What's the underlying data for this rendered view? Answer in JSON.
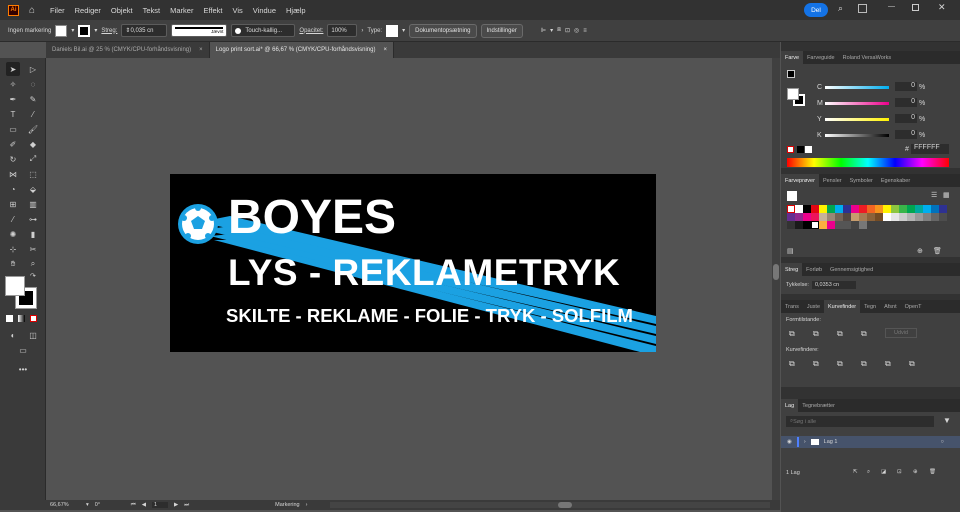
{
  "menu": {
    "items": [
      "Filer",
      "Rediger",
      "Objekt",
      "Tekst",
      "Marker",
      "Effekt",
      "Vis",
      "Vindue",
      "Hjælp"
    ],
    "share": "Del"
  },
  "control": {
    "selection": "Ingen markering",
    "stroke_label": "Streg:",
    "stroke_value": "0,035 cn",
    "brush_profile": "Jævnt",
    "brush_name": "Touch-kallig...",
    "opacity_label": "Opacitet:",
    "opacity_value": "100%",
    "style_label": "Type:",
    "doc_setup": "Dokumentopsætning",
    "prefs": "Indstillinger"
  },
  "tabs": [
    {
      "label": "Daniels Bil.ai @ 25 % (CMYK/CPU-forhåndsvisning)",
      "close": "×"
    },
    {
      "label": "Logo print sort.ai* @ 66,67 % (CMYK/CPU-forhåndsvisning)",
      "close": "×"
    }
  ],
  "artwork": {
    "line1": "BOYES",
    "line2": "LYS - REKLAMETRYK",
    "line3": "SKILTE - REKLAME - FOLIE - TRYK - SOLFILM"
  },
  "status": {
    "zoom": "66,67%",
    "rotate": "0°",
    "page": "1",
    "mode": "Markering"
  },
  "color_panel": {
    "tabs": [
      "Farve",
      "Farveguide",
      "Roland VersaWorks"
    ],
    "channels": [
      {
        "label": "C",
        "value": "0",
        "unit": "%"
      },
      {
        "label": "M",
        "value": "0",
        "unit": "%"
      },
      {
        "label": "Y",
        "value": "0",
        "unit": "%"
      },
      {
        "label": "K",
        "value": "0",
        "unit": "%"
      }
    ],
    "hex_prefix": "#",
    "hex": "FFFFFF"
  },
  "swatch_panel": {
    "tabs": [
      "Farveprøver",
      "Pensler",
      "Symboler",
      "Egenskaber"
    ]
  },
  "stroke_panel": {
    "tabs": [
      "Streg",
      "Forløb",
      "Gennemsigtighed"
    ],
    "weight_label": "Tykkelse:",
    "weight_value": "0,0353 cn"
  },
  "pathfinder_panel": {
    "tabs": [
      "Trans",
      "Juste",
      "Kurvefinder",
      "Tegn",
      "Afsnt",
      "OpenT"
    ],
    "shape_modes": "Formtilstande:",
    "expand": "Udvid",
    "pathfinders": "Kurvefindere:"
  },
  "layers_panel": {
    "tabs": [
      "Lag",
      "Tegnebrætter"
    ],
    "search": "Søg i alle",
    "layer": "Lag 1",
    "count": "1 Lag"
  },
  "colors": {
    "accent": "#1ba1e2",
    "brand": "#ff7c00"
  }
}
